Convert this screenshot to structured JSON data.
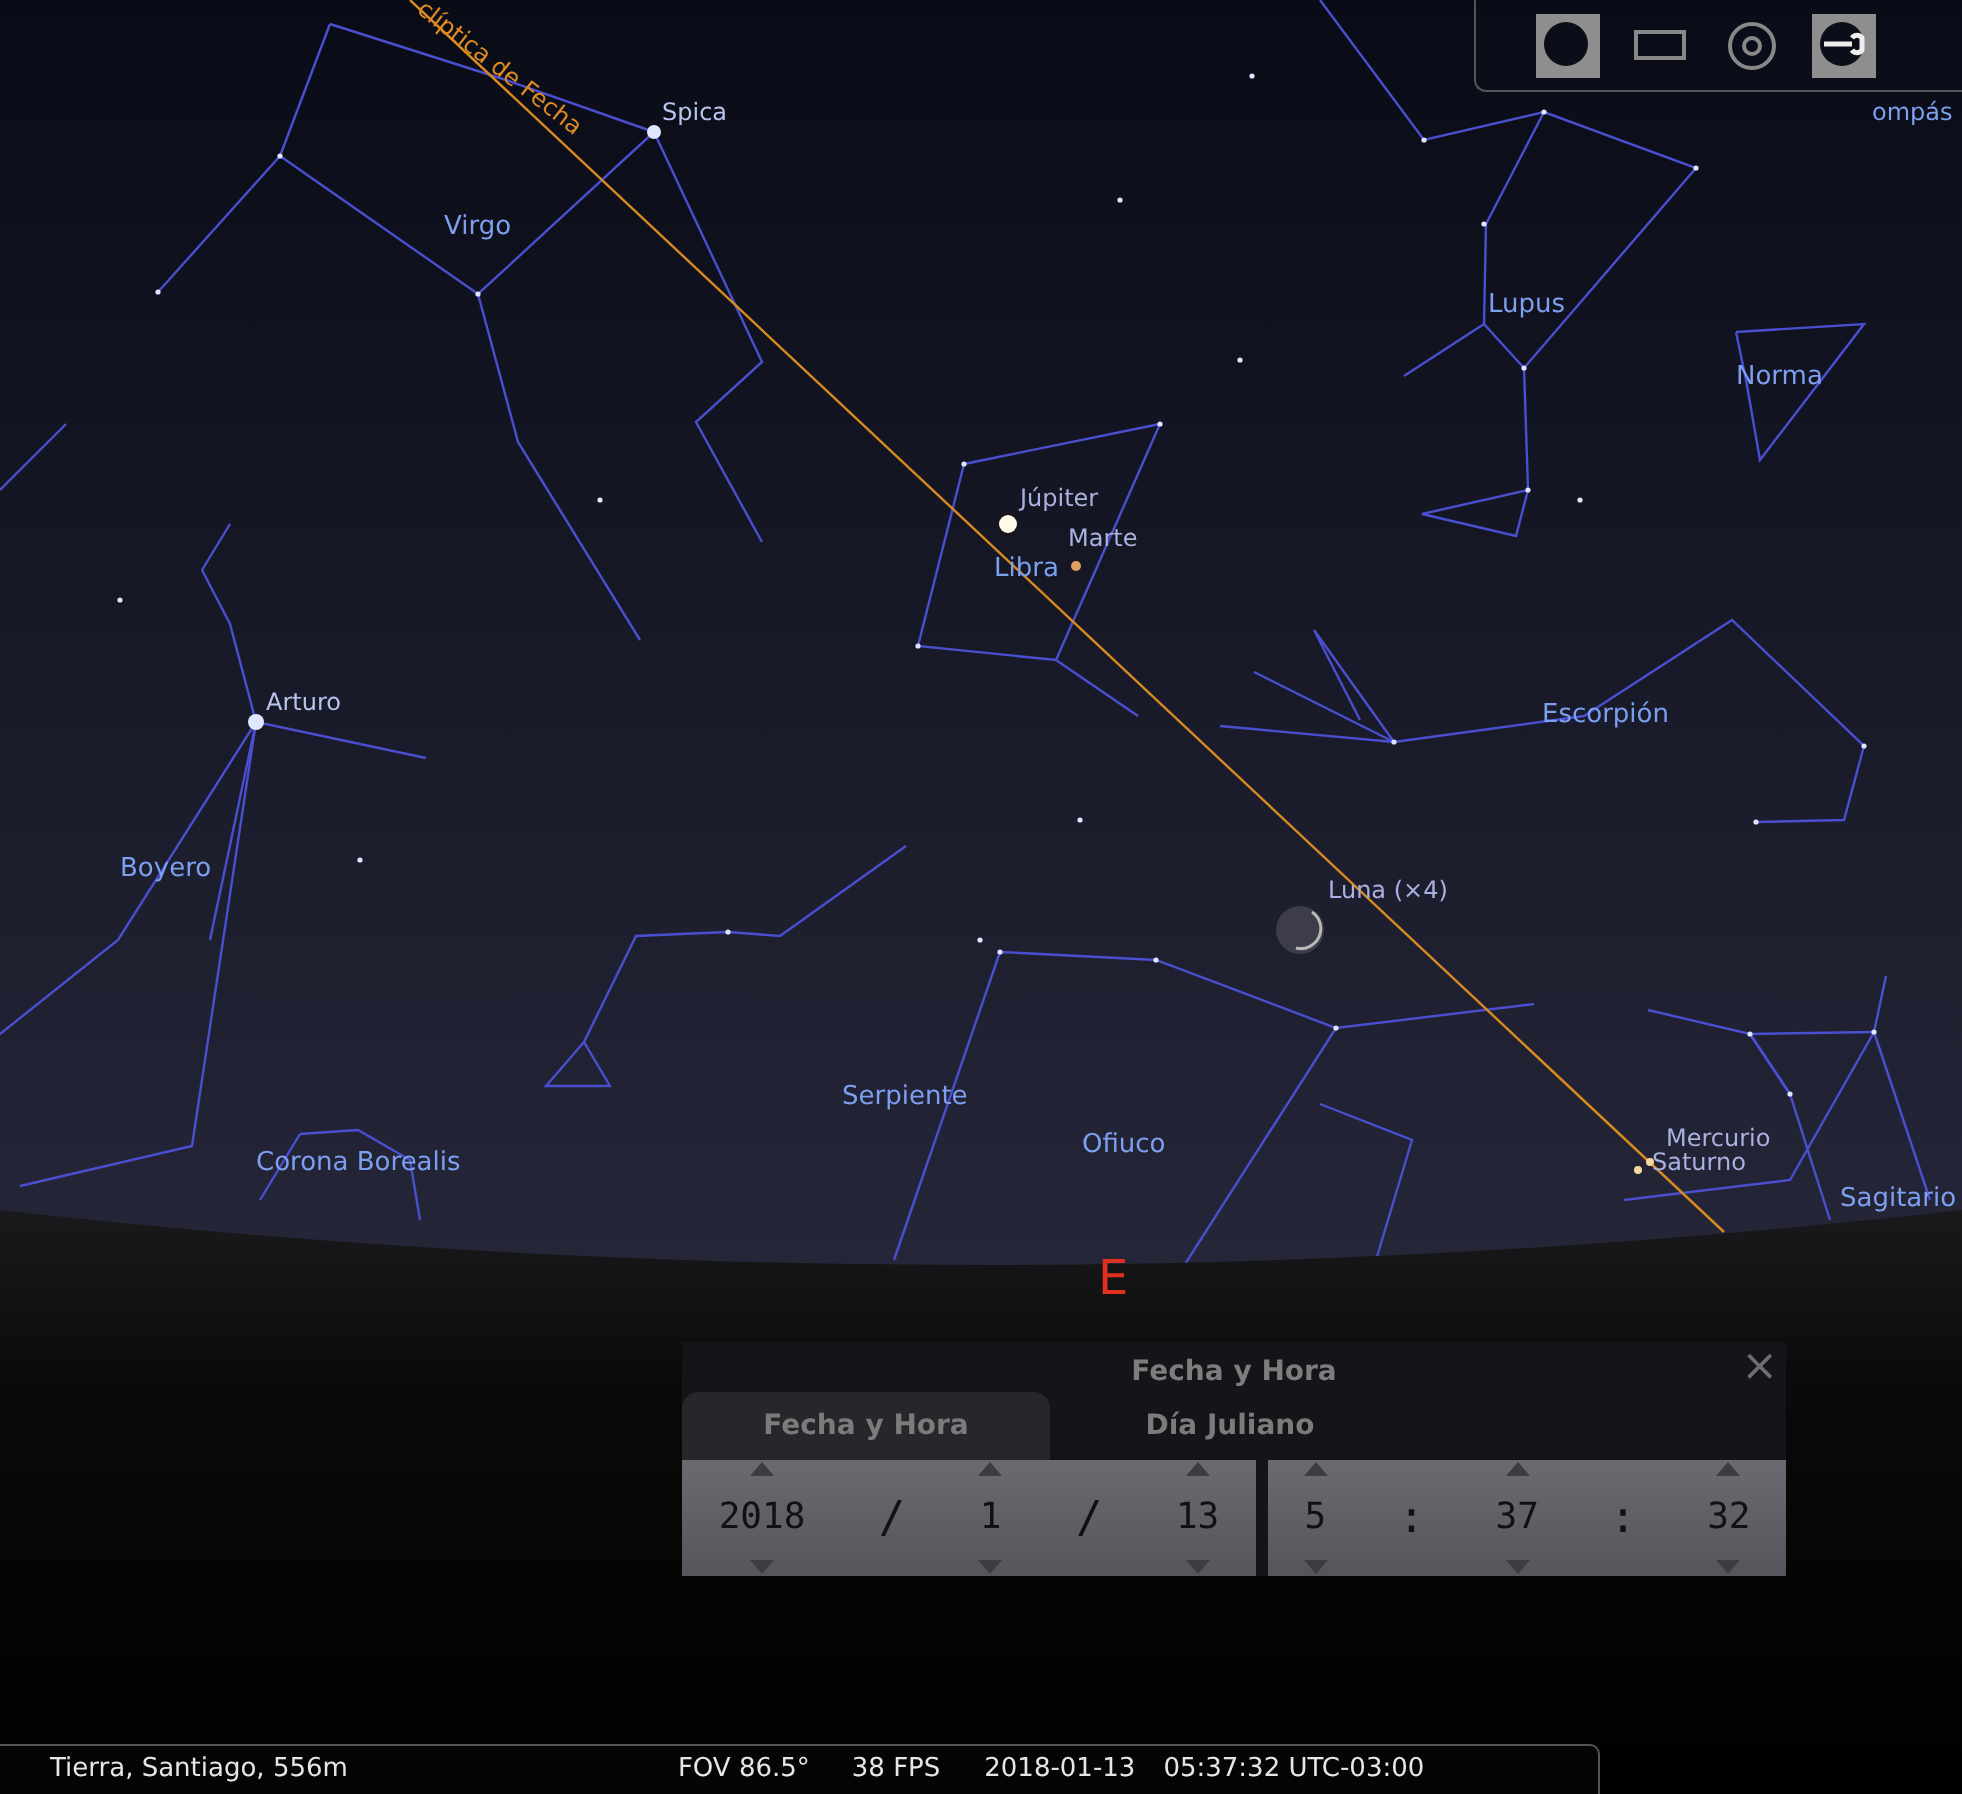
{
  "toolbar": {
    "buttons": [
      {
        "kind": "disc",
        "on": true
      },
      {
        "kind": "frame",
        "on": false
      },
      {
        "kind": "target",
        "on": false
      },
      {
        "kind": "wrench",
        "on": true
      }
    ],
    "partial_label": "ompás"
  },
  "sky": {
    "ecliptic_label": "clíptica de Fecha",
    "labels": [
      {
        "kind": "star",
        "text": "Spica"
      },
      {
        "kind": "constellation",
        "text": "Virgo"
      },
      {
        "kind": "constellation",
        "text": "Lupus"
      },
      {
        "kind": "constellation",
        "text": "Norma"
      },
      {
        "kind": "planet",
        "text": "Júpiter"
      },
      {
        "kind": "planet",
        "text": "Marte"
      },
      {
        "kind": "constellation",
        "text": "Libra"
      },
      {
        "kind": "star",
        "text": "Arturo"
      },
      {
        "kind": "constellation",
        "text": "Escorpión"
      },
      {
        "kind": "constellation",
        "text": "Boyero"
      },
      {
        "kind": "planet",
        "text": "Luna (×4)"
      },
      {
        "kind": "constellation",
        "text": "Serpiente"
      },
      {
        "kind": "constellation",
        "text": "Ofiuco"
      },
      {
        "kind": "constellation",
        "text": "Corona Borealis"
      },
      {
        "kind": "planet",
        "text": "Mercurio"
      },
      {
        "kind": "planet",
        "text": "Saturno"
      },
      {
        "kind": "constellation",
        "text": "Sagitario"
      }
    ],
    "cardinal": "E"
  },
  "dialog": {
    "title": "Fecha y Hora",
    "close": "×",
    "tabs": [
      {
        "label": "Fecha y Hora",
        "selected": true
      },
      {
        "label": "Día Juliano",
        "selected": false
      }
    ],
    "date": {
      "values": [
        "2018",
        "1",
        "13"
      ],
      "separators": [
        "/",
        "/"
      ]
    },
    "time": {
      "values": [
        "5",
        "37",
        "32"
      ],
      "separators": [
        ":",
        ":"
      ]
    }
  },
  "status_bar": {
    "location": "Tierra, Santiago, 556m",
    "fov": "FOV 86.5°",
    "fps": "38 FPS",
    "date": "2018-01-13",
    "time": "05:37:32 UTC-03:00"
  }
}
